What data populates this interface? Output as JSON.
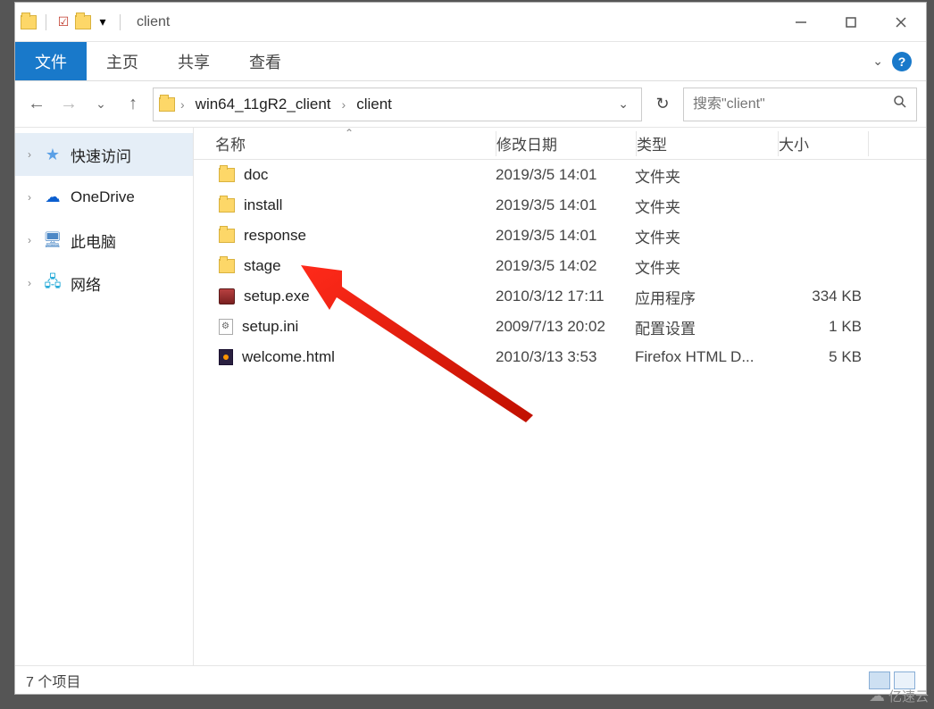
{
  "titlebar": {
    "title": "client"
  },
  "ribbon": {
    "file": "文件",
    "home": "主页",
    "share": "共享",
    "view": "查看"
  },
  "address": {
    "crumb1": "win64_11gR2_client",
    "crumb2": "client",
    "search_placeholder": "搜索\"client\""
  },
  "sidebar": {
    "quick": "快速访问",
    "onedrive": "OneDrive",
    "thispc": "此电脑",
    "network": "网络"
  },
  "columns": {
    "name": "名称",
    "date": "修改日期",
    "type": "类型",
    "size": "大小"
  },
  "files": [
    {
      "name": "doc",
      "date": "2019/3/5 14:01",
      "type": "文件夹",
      "size": "",
      "icon": "folder"
    },
    {
      "name": "install",
      "date": "2019/3/5 14:01",
      "type": "文件夹",
      "size": "",
      "icon": "folder"
    },
    {
      "name": "response",
      "date": "2019/3/5 14:01",
      "type": "文件夹",
      "size": "",
      "icon": "folder"
    },
    {
      "name": "stage",
      "date": "2019/3/5 14:02",
      "type": "文件夹",
      "size": "",
      "icon": "folder"
    },
    {
      "name": "setup.exe",
      "date": "2010/3/12 17:11",
      "type": "应用程序",
      "size": "334 KB",
      "icon": "exe"
    },
    {
      "name": "setup.ini",
      "date": "2009/7/13 20:02",
      "type": "配置设置",
      "size": "1 KB",
      "icon": "ini"
    },
    {
      "name": "welcome.html",
      "date": "2010/3/13 3:53",
      "type": "Firefox HTML D...",
      "size": "5 KB",
      "icon": "html"
    }
  ],
  "status": {
    "count": "7 个项目"
  },
  "watermark": "亿速云"
}
